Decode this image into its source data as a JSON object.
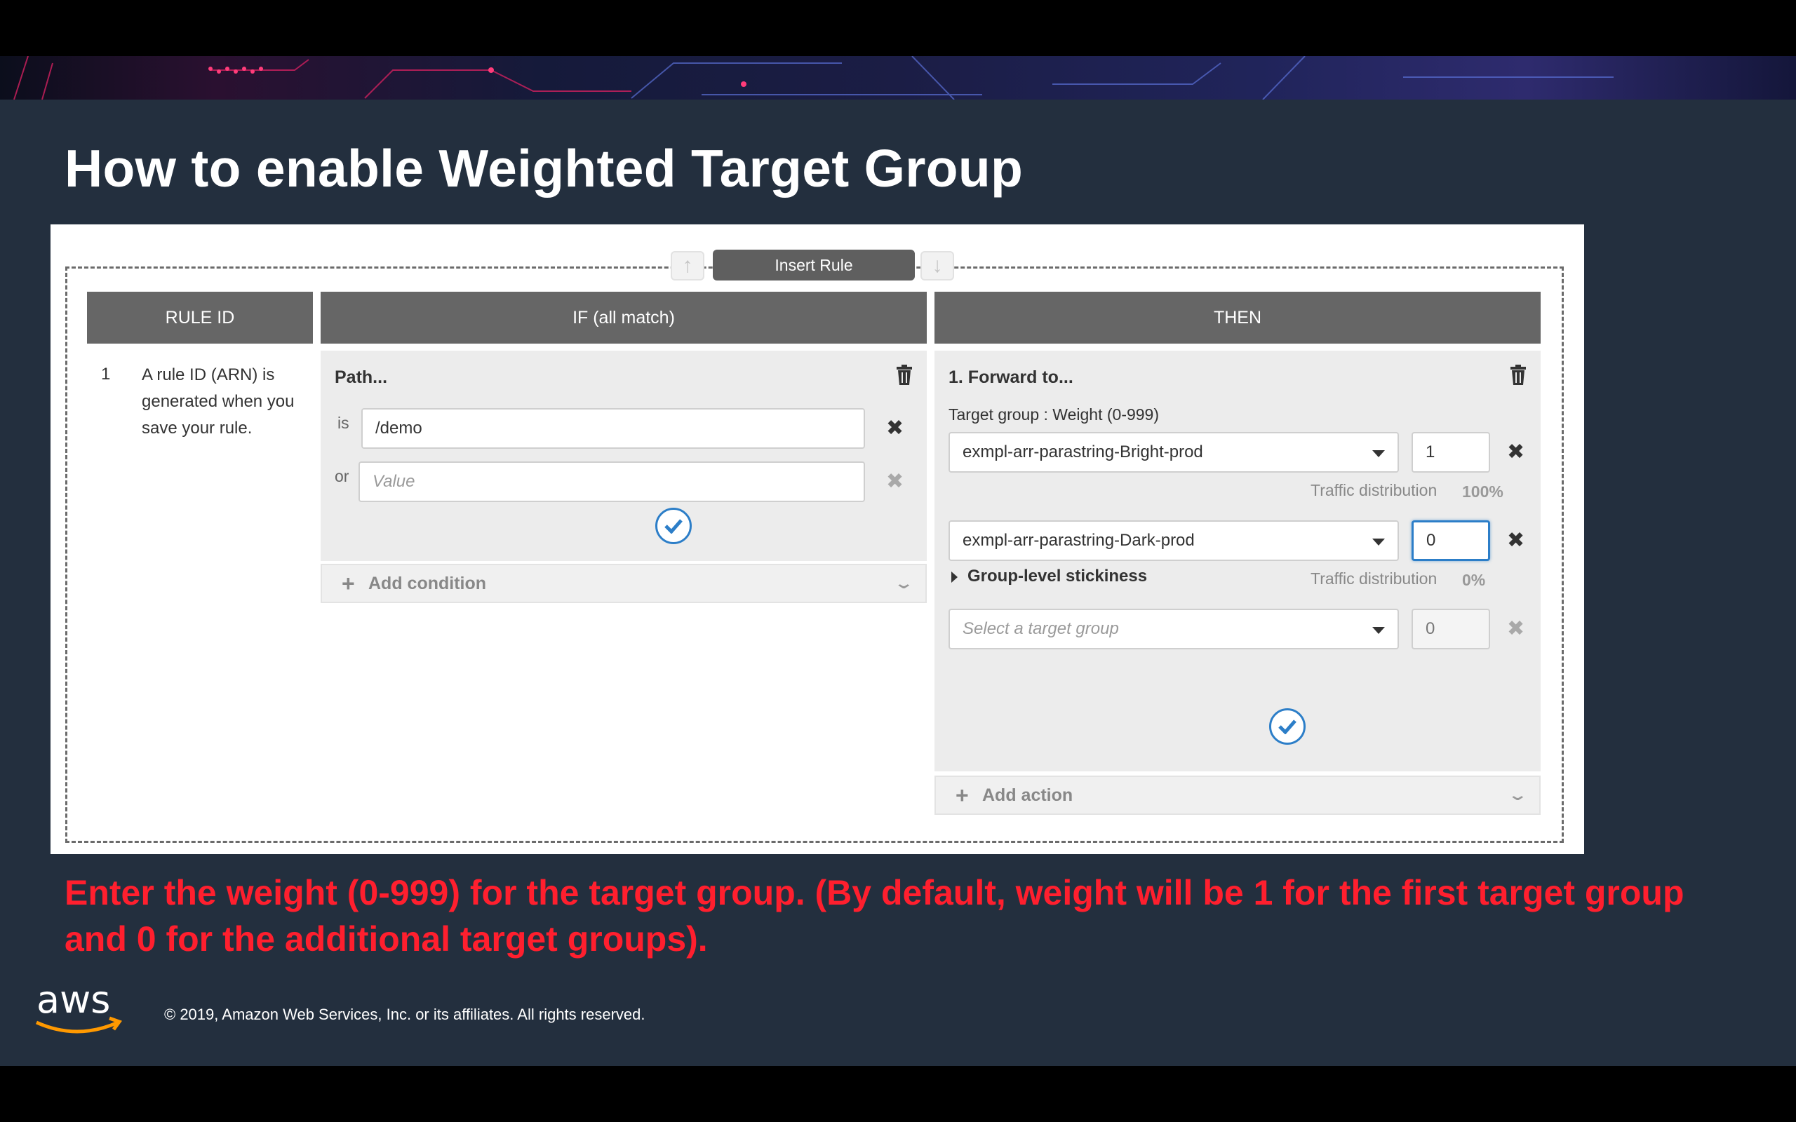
{
  "slide": {
    "title": "How to enable Weighted Target Group",
    "caption": "Enter the weight (0-999) for the target group. (By default, weight will be 1 for the first target group and 0 for the additional target groups).",
    "copyright": "© 2019, Amazon Web Services, Inc. or its affiliates. All rights reserved.",
    "logo_text": "aws"
  },
  "toolbar": {
    "insert_rule_label": "Insert Rule",
    "move_up_glyph": "↑",
    "move_down_glyph": "↓"
  },
  "columns": {
    "rule_id": "RULE ID",
    "if": "IF (all match)",
    "then": "THEN"
  },
  "rule": {
    "number": "1",
    "description": "A rule ID (ARN) is generated when you save your rule."
  },
  "condition": {
    "title": "Path...",
    "is_label": "is",
    "or_label": "or",
    "path_value": "/demo",
    "value_placeholder": "Value",
    "add_condition_label": "Add condition"
  },
  "action": {
    "title": "1. Forward to...",
    "target_group_label": "Target group : Weight (0-999)",
    "distribution_label": "Traffic distribution",
    "target_groups": [
      {
        "name": "exmpl-arr-parastring-Bright-prod",
        "weight": "1",
        "distribution": "100%"
      },
      {
        "name": "exmpl-arr-parastring-Dark-prod",
        "weight": "0",
        "distribution": "0%"
      }
    ],
    "new_group_placeholder": "Select a target group",
    "new_group_weight": "0",
    "stickiness_label": "Group-level stickiness",
    "add_action_label": "Add action"
  },
  "colors": {
    "slide_background": "#232f3e",
    "caption_red": "#ff1f2e",
    "header_gray": "#666666",
    "focus_blue": "#2c7ec8",
    "aws_orange": "#ff9900"
  },
  "icons": {
    "delete": "trash-icon",
    "remove": "close-icon",
    "confirm": "check-icon",
    "add": "plus-icon",
    "expand": "chevron-down-icon",
    "dropdown": "caret-down-icon",
    "disclosure": "triangle-right-icon"
  }
}
